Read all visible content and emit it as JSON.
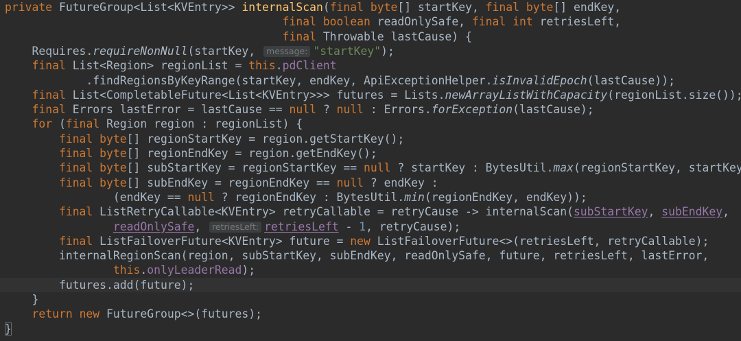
{
  "colors": {
    "background": "#2b2b2b",
    "current_line": "#323232",
    "default": "#a9b7c6",
    "keyword": "#cc7832",
    "method": "#ffc66d",
    "string": "#6a8759",
    "field": "#9876aa",
    "number": "#6897bb",
    "hint_bg": "#3b3f41",
    "hint_text": "#787878"
  },
  "code": [
    {
      "indent": "",
      "tokens": [
        {
          "t": "private ",
          "c": "kw"
        },
        {
          "t": "FutureGroup<List<KVEntry>> "
        },
        {
          "t": "internalScan",
          "c": "fn"
        },
        {
          "t": "("
        },
        {
          "t": "final ",
          "c": "kw"
        },
        {
          "t": "byte",
          "c": "kw"
        },
        {
          "t": "[] startKey, "
        },
        {
          "t": "final ",
          "c": "kw"
        },
        {
          "t": "byte",
          "c": "kw"
        },
        {
          "t": "[] endKey,"
        }
      ]
    },
    {
      "indent": "                                         ",
      "tokens": [
        {
          "t": "final ",
          "c": "kw"
        },
        {
          "t": "boolean ",
          "c": "kw"
        },
        {
          "t": "readOnlySafe, "
        },
        {
          "t": "final ",
          "c": "kw"
        },
        {
          "t": "int ",
          "c": "kw"
        },
        {
          "t": "retriesLeft,"
        }
      ]
    },
    {
      "indent": "                                         ",
      "tokens": [
        {
          "t": "final ",
          "c": "kw"
        },
        {
          "t": "Throwable lastCause) {"
        }
      ]
    },
    {
      "indent": "    ",
      "tokens": [
        {
          "t": "Requires."
        },
        {
          "t": "requireNonNull",
          "c": "it"
        },
        {
          "t": "(startKey, "
        },
        {
          "t": "message:",
          "c": "hint"
        },
        {
          "t": "\"startKey\"",
          "c": "str"
        },
        {
          "t": ");"
        }
      ]
    },
    {
      "indent": "    ",
      "tokens": [
        {
          "t": "final ",
          "c": "kw"
        },
        {
          "t": "List<Region> regionList = "
        },
        {
          "t": "this",
          "c": "kw"
        },
        {
          "t": "."
        },
        {
          "t": "pdClient",
          "c": "field"
        }
      ]
    },
    {
      "indent": "            ",
      "tokens": [
        {
          "t": ".findRegionsByKeyRange(startKey, endKey, ApiExceptionHelper."
        },
        {
          "t": "isInvalidEpoch",
          "c": "it"
        },
        {
          "t": "(lastCause));"
        }
      ]
    },
    {
      "indent": "    ",
      "tokens": [
        {
          "t": "final ",
          "c": "kw"
        },
        {
          "t": "List<CompletableFuture<List<KVEntry>>> futures = Lists."
        },
        {
          "t": "newArrayListWithCapacity",
          "c": "it"
        },
        {
          "t": "(regionList.size());"
        }
      ]
    },
    {
      "indent": "    ",
      "tokens": [
        {
          "t": "final ",
          "c": "kw"
        },
        {
          "t": "Errors lastError = lastCause == "
        },
        {
          "t": "null",
          "c": "kw"
        },
        {
          "t": " ? "
        },
        {
          "t": "null",
          "c": "kw"
        },
        {
          "t": " : Errors."
        },
        {
          "t": "forException",
          "c": "it"
        },
        {
          "t": "(lastCause);"
        }
      ]
    },
    {
      "indent": "    ",
      "tokens": [
        {
          "t": "for ",
          "c": "kw"
        },
        {
          "t": "("
        },
        {
          "t": "final ",
          "c": "kw"
        },
        {
          "t": "Region region : regionList) {"
        }
      ]
    },
    {
      "indent": "        ",
      "tokens": [
        {
          "t": "final ",
          "c": "kw"
        },
        {
          "t": "byte",
          "c": "kw"
        },
        {
          "t": "[] regionStartKey = region.getStartKey();"
        }
      ]
    },
    {
      "indent": "        ",
      "tokens": [
        {
          "t": "final ",
          "c": "kw"
        },
        {
          "t": "byte",
          "c": "kw"
        },
        {
          "t": "[] regionEndKey = region.getEndKey();"
        }
      ]
    },
    {
      "indent": "        ",
      "tokens": [
        {
          "t": "final ",
          "c": "kw"
        },
        {
          "t": "byte",
          "c": "kw"
        },
        {
          "t": "[] subStartKey = regionStartKey == "
        },
        {
          "t": "null",
          "c": "kw"
        },
        {
          "t": " ? startKey : BytesUtil."
        },
        {
          "t": "max",
          "c": "it"
        },
        {
          "t": "(regionStartKey, startKey);"
        }
      ]
    },
    {
      "indent": "        ",
      "tokens": [
        {
          "t": "final ",
          "c": "kw"
        },
        {
          "t": "byte",
          "c": "kw"
        },
        {
          "t": "[] subEndKey = regionEndKey == "
        },
        {
          "t": "null",
          "c": "kw"
        },
        {
          "t": " ? endKey :"
        }
      ]
    },
    {
      "indent": "                ",
      "tokens": [
        {
          "t": "(endKey == "
        },
        {
          "t": "null",
          "c": "kw"
        },
        {
          "t": " ? regionEndKey : BytesUtil."
        },
        {
          "t": "min",
          "c": "it"
        },
        {
          "t": "(regionEndKey, endKey));"
        }
      ]
    },
    {
      "indent": "        ",
      "tokens": [
        {
          "t": "final ",
          "c": "kw"
        },
        {
          "t": "ListRetryCallable<KVEntry> retryCallable = retryCause -> internalScan("
        },
        {
          "t": "subStartKey",
          "c": "field ul"
        },
        {
          "t": ", "
        },
        {
          "t": "subEndKey",
          "c": "field ul"
        },
        {
          "t": ","
        }
      ]
    },
    {
      "indent": "                ",
      "tokens": [
        {
          "t": "readOnlySafe",
          "c": "field ul"
        },
        {
          "t": ", "
        },
        {
          "t": "retriesLeft:",
          "c": "hint"
        },
        {
          "t": "retriesLeft",
          "c": "field ul"
        },
        {
          "t": " - "
        },
        {
          "t": "1",
          "c": "num"
        },
        {
          "t": ", retryCause);"
        }
      ]
    },
    {
      "indent": "        ",
      "tokens": [
        {
          "t": "final ",
          "c": "kw"
        },
        {
          "t": "ListFailoverFuture<KVEntry> future = "
        },
        {
          "t": "new ",
          "c": "kw"
        },
        {
          "t": "ListFailoverFuture<>(retriesLeft, retryCallable);"
        }
      ]
    },
    {
      "indent": "        ",
      "tokens": [
        {
          "t": "internalRegionScan(region, subStartKey, subEndKey, readOnlySafe, future, retriesLeft, lastError,"
        }
      ]
    },
    {
      "indent": "                ",
      "tokens": [
        {
          "t": "this",
          "c": "kw"
        },
        {
          "t": "."
        },
        {
          "t": "onlyLeaderRead",
          "c": "field"
        },
        {
          "t": ");"
        }
      ]
    },
    {
      "indent": "        ",
      "current": true,
      "tokens": [
        {
          "t": "futures.add(future);"
        }
      ]
    },
    {
      "indent": "    ",
      "tokens": [
        {
          "t": "}"
        }
      ]
    },
    {
      "indent": "    ",
      "tokens": [
        {
          "t": "return ",
          "c": "kw"
        },
        {
          "t": "new ",
          "c": "kw"
        },
        {
          "t": "FutureGroup<>(futures);"
        }
      ]
    },
    {
      "indent": "",
      "tokens": [
        {
          "t": "}",
          "c": "brace-match"
        }
      ]
    }
  ]
}
